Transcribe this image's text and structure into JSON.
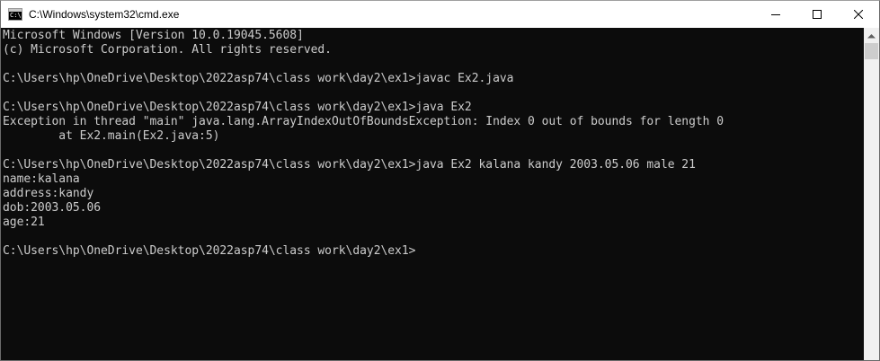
{
  "window": {
    "title": "C:\\Windows\\system32\\cmd.exe",
    "icon": "cmd-icon",
    "controls": [
      "minimize-icon",
      "maximize-icon",
      "close-icon"
    ]
  },
  "console": {
    "lines": [
      "Microsoft Windows [Version 10.0.19045.5608]",
      "(c) Microsoft Corporation. All rights reserved.",
      "",
      "C:\\Users\\hp\\OneDrive\\Desktop\\2022asp74\\class work\\day2\\ex1>javac Ex2.java",
      "",
      "C:\\Users\\hp\\OneDrive\\Desktop\\2022asp74\\class work\\day2\\ex1>java Ex2",
      "Exception in thread \"main\" java.lang.ArrayIndexOutOfBoundsException: Index 0 out of bounds for length 0",
      "        at Ex2.main(Ex2.java:5)",
      "",
      "C:\\Users\\hp\\OneDrive\\Desktop\\2022asp74\\class work\\day2\\ex1>java Ex2 kalana kandy 2003.05.06 male 21",
      "name:kalana",
      "address:kandy",
      "dob:2003.05.06",
      "age:21",
      "",
      "C:\\Users\\hp\\OneDrive\\Desktop\\2022asp74\\class work\\day2\\ex1>"
    ]
  },
  "colors": {
    "console_bg": "#0c0c0c",
    "console_text": "#cccccc",
    "titlebar_bg": "#ffffff",
    "scrollbar_bg": "#f0f0f0"
  }
}
